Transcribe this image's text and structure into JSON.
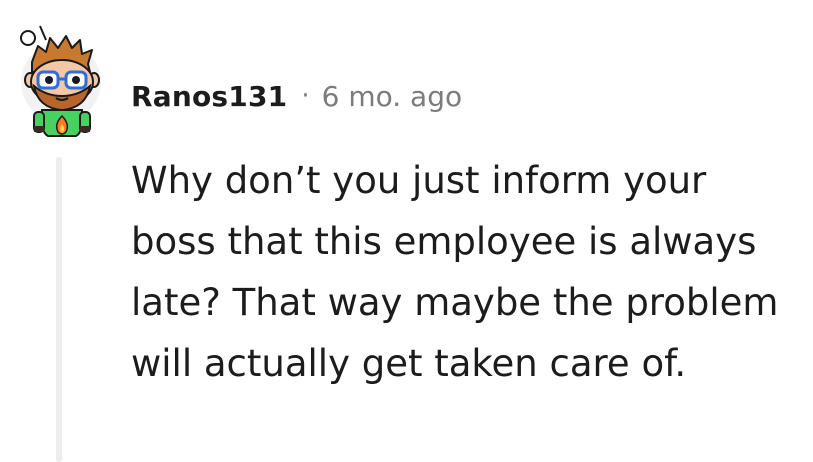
{
  "comment": {
    "username": "Ranos131",
    "separator": "·",
    "timestamp": "6 mo. ago",
    "body": "Why don’t you just inform your boss that this employee is always late? That way maybe the problem will actually get taken care of."
  },
  "colors": {
    "text_primary": "#1c1c1c",
    "text_meta": "#7c7c7c",
    "thread_line": "#ededed",
    "avatar_shirt": "#46d160"
  },
  "icons": {
    "avatar": "snoo-avatar-icon"
  }
}
